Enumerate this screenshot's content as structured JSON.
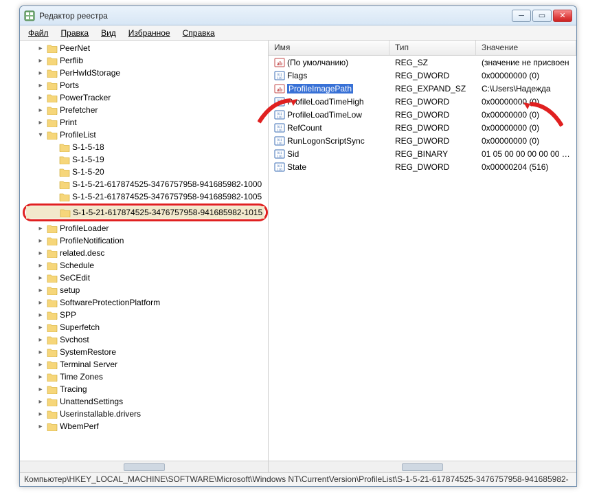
{
  "window": {
    "title": "Редактор реестра"
  },
  "menu": {
    "file": "Файл",
    "edit": "Правка",
    "view": "Вид",
    "favorites": "Избранное",
    "help": "Справка"
  },
  "tree": {
    "items": [
      {
        "label": "PeerNet",
        "depth": 1
      },
      {
        "label": "Perflib",
        "depth": 1
      },
      {
        "label": "PerHwIdStorage",
        "depth": 1
      },
      {
        "label": "Ports",
        "depth": 1
      },
      {
        "label": "PowerTracker",
        "depth": 1
      },
      {
        "label": "Prefetcher",
        "depth": 1
      },
      {
        "label": "Print",
        "depth": 1
      },
      {
        "label": "ProfileList",
        "depth": 1,
        "expanded": true
      },
      {
        "label": "S-1-5-18",
        "depth": 2
      },
      {
        "label": "S-1-5-19",
        "depth": 2
      },
      {
        "label": "S-1-5-20",
        "depth": 2
      },
      {
        "label": "S-1-5-21-617874525-3476757958-941685982-1000",
        "depth": 2
      },
      {
        "label": "S-1-5-21-617874525-3476757958-941685982-1005",
        "depth": 2
      },
      {
        "label": "S-1-5-21-617874525-3476757958-941685982-1015",
        "depth": 2,
        "highlighted": true
      },
      {
        "label": "ProfileLoader",
        "depth": 1
      },
      {
        "label": "ProfileNotification",
        "depth": 1
      },
      {
        "label": "related.desc",
        "depth": 1
      },
      {
        "label": "Schedule",
        "depth": 1
      },
      {
        "label": "SeCEdit",
        "depth": 1
      },
      {
        "label": "setup",
        "depth": 1
      },
      {
        "label": "SoftwareProtectionPlatform",
        "depth": 1
      },
      {
        "label": "SPP",
        "depth": 1
      },
      {
        "label": "Superfetch",
        "depth": 1
      },
      {
        "label": "Svchost",
        "depth": 1
      },
      {
        "label": "SystemRestore",
        "depth": 1
      },
      {
        "label": "Terminal Server",
        "depth": 1
      },
      {
        "label": "Time Zones",
        "depth": 1
      },
      {
        "label": "Tracing",
        "depth": 1
      },
      {
        "label": "UnattendSettings",
        "depth": 1
      },
      {
        "label": "Userinstallable.drivers",
        "depth": 1
      },
      {
        "label": "WbemPerf",
        "depth": 1
      }
    ]
  },
  "columns": {
    "name": "Имя",
    "type": "Тип",
    "value": "Значение"
  },
  "values_list": [
    {
      "icon": "sz",
      "name": "(По умолчанию)",
      "type": "REG_SZ",
      "value": "(значение не присвоен"
    },
    {
      "icon": "bin",
      "name": "Flags",
      "type": "REG_DWORD",
      "value": "0x00000000 (0)"
    },
    {
      "icon": "sz",
      "name": "ProfileImagePath",
      "type": "REG_EXPAND_SZ",
      "value": "C:\\Users\\Надежда",
      "selected": true
    },
    {
      "icon": "bin",
      "name": "ProfileLoadTimeHigh",
      "type": "REG_DWORD",
      "value": "0x00000000 (0)"
    },
    {
      "icon": "bin",
      "name": "ProfileLoadTimeLow",
      "type": "REG_DWORD",
      "value": "0x00000000 (0)"
    },
    {
      "icon": "bin",
      "name": "RefCount",
      "type": "REG_DWORD",
      "value": "0x00000000 (0)"
    },
    {
      "icon": "bin",
      "name": "RunLogonScriptSync",
      "type": "REG_DWORD",
      "value": "0x00000000 (0)"
    },
    {
      "icon": "bin",
      "name": "Sid",
      "type": "REG_BINARY",
      "value": "01 05 00 00 00 00 00 05 1"
    },
    {
      "icon": "bin",
      "name": "State",
      "type": "REG_DWORD",
      "value": "0x00000204 (516)"
    }
  ],
  "statusbar": "Компьютер\\HKEY_LOCAL_MACHINE\\SOFTWARE\\Microsoft\\Windows NT\\CurrentVersion\\ProfileList\\S-1-5-21-617874525-3476757958-941685982-"
}
